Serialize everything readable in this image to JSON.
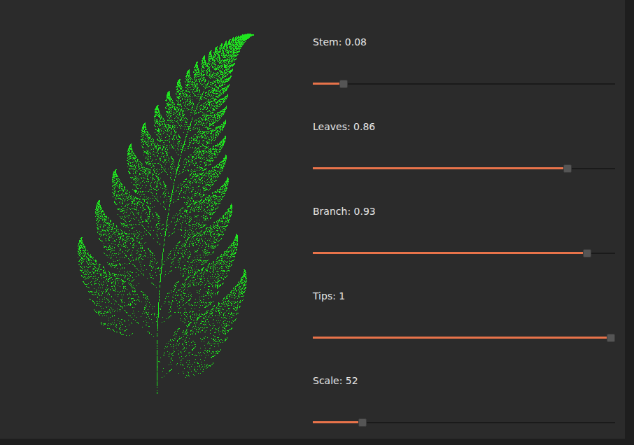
{
  "window": {
    "title": ""
  },
  "fern": {
    "color": "#1fe61f"
  },
  "sliders": [
    {
      "label": "Stem: 0.08",
      "level": 0.09
    },
    {
      "label": "Leaves: 0.86",
      "level": 0.853
    },
    {
      "label": "Branch: 0.93",
      "level": 0.92
    },
    {
      "label": "Tips: 1",
      "level": 1
    },
    {
      "label": "Scale: 52",
      "level": 0.155
    }
  ]
}
